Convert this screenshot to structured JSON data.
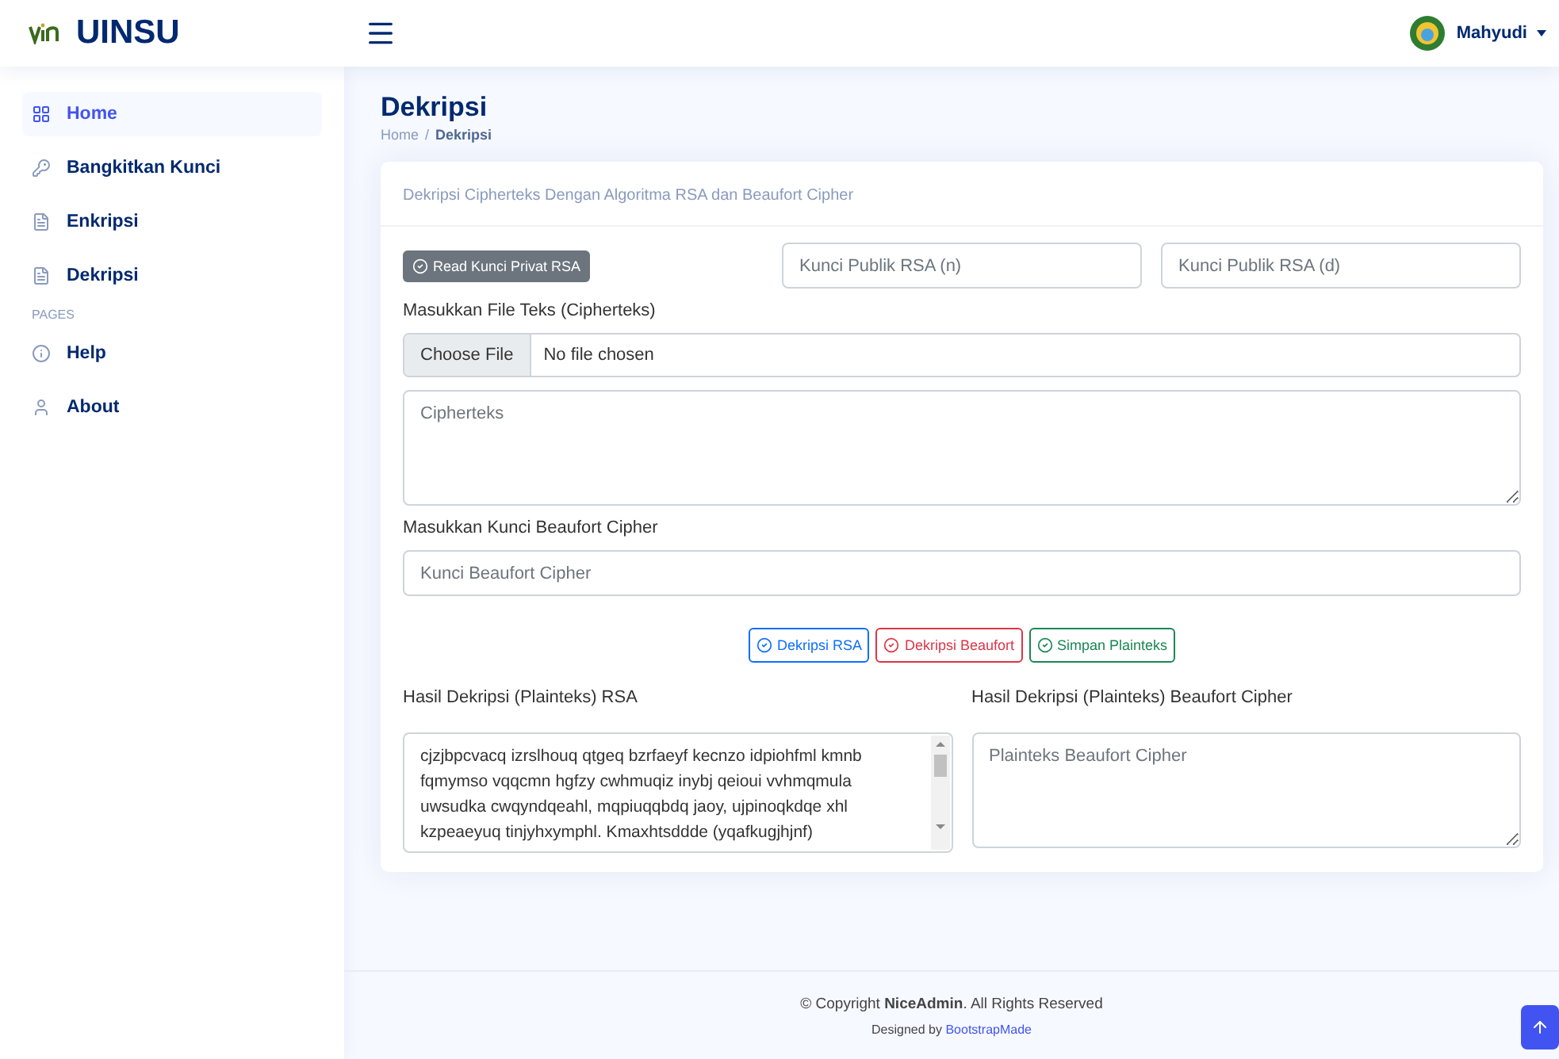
{
  "brand": "UINSU",
  "user": {
    "name": "Mahyudi"
  },
  "sidebar": {
    "items": [
      {
        "label": "Home",
        "selected": true
      },
      {
        "label": "Bangkitkan Kunci",
        "selected": false
      },
      {
        "label": "Enkripsi",
        "selected": false
      },
      {
        "label": "Dekripsi",
        "selected": false
      }
    ],
    "section": "PAGES",
    "pages": [
      {
        "label": "Help",
        "selected": false
      },
      {
        "label": "About",
        "selected": false
      }
    ]
  },
  "page": {
    "title": "Dekripsi",
    "breadcrumb": [
      "Home",
      "Dekripsi"
    ],
    "breadcrumb_separator": "/"
  },
  "card": {
    "title": "Dekripsi Cipherteks Dengan Algoritma RSA dan Beaufort Cipher",
    "read_button": "Read Kunci Privat RSA",
    "key_n": {
      "placeholder": "Kunci Publik RSA (n)"
    },
    "key_d": {
      "placeholder": "Kunci Publik RSA (d)"
    },
    "file_label": "Masukkan File Teks (Cipherteks)",
    "file": {
      "button": "Choose File",
      "status": "No file chosen"
    },
    "ciphertext": {
      "placeholder": "Cipherteks"
    },
    "beaufort_label": "Masukkan Kunci Beaufort Cipher",
    "beaufort_key": {
      "placeholder": "Kunci Beaufort Cipher"
    },
    "actions": [
      {
        "label": "Dekripsi RSA",
        "color": "#0d6efd"
      },
      {
        "label": "Dekripsi Beaufort",
        "color": "#dc3545"
      },
      {
        "label": "Simpan Plainteks",
        "color": "#198754"
      }
    ],
    "rsa_label": "Hasil Dekripsi (Plainteks) RSA",
    "rsa_result": {
      "value": " cjzjbpcvacq izrslhouq qtgeq bzrfaeyf kecnzo idpiohfml kmnb fqmymso vqqcmn hgfzy cwhmuqiz inybj qeioui vvhmqmula uwsudka cwqyndqeahl, mqpiuqqbdq jaoy, ujpinoqkdqe xhl kzpeaeyuq tinjyhxymphl. Kmaxhtsddde (yqafkugjhjnf)"
    },
    "beaufort_result_label": "Hasil Dekripsi (Plainteks) Beaufort Cipher",
    "beaufort_result": {
      "placeholder": "Plainteks Beaufort Cipher"
    }
  },
  "footer": {
    "copyright": "© Copyright **NiceAdmin**. All Rights Reserved",
    "credit_prefix": "Designed by",
    "credit_link": "BootstrapMade"
  }
}
